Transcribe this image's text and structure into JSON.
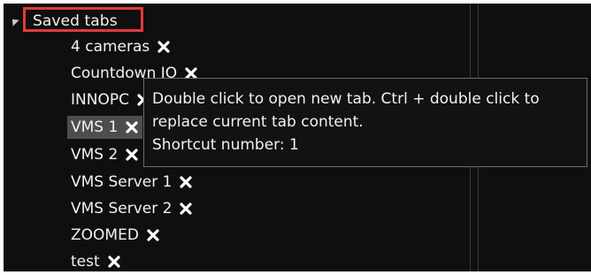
{
  "tree": {
    "group_label": "Saved tabs",
    "items": [
      {
        "label": "4 cameras"
      },
      {
        "label": "Countdown IO"
      },
      {
        "label": "INNOPC"
      },
      {
        "label": "VMS 1"
      },
      {
        "label": "VMS 2"
      },
      {
        "label": "VMS Server 1"
      },
      {
        "label": "VMS Server 2"
      },
      {
        "label": "ZOOMED"
      },
      {
        "label": "test"
      }
    ],
    "selected_index": 3
  },
  "tooltip": {
    "line1": "Double click to open new tab. Ctrl + double click to",
    "line2": "replace current tab content.",
    "line3": "Shortcut number: 1"
  },
  "colors": {
    "background": "#0f0f10",
    "highlight_border": "#e03a3a",
    "selected_row": "#4d4d4d",
    "text": "#f2f2f2"
  },
  "icons": {
    "expander": "collapse-triangle-icon",
    "remove": "close-x-icon"
  }
}
